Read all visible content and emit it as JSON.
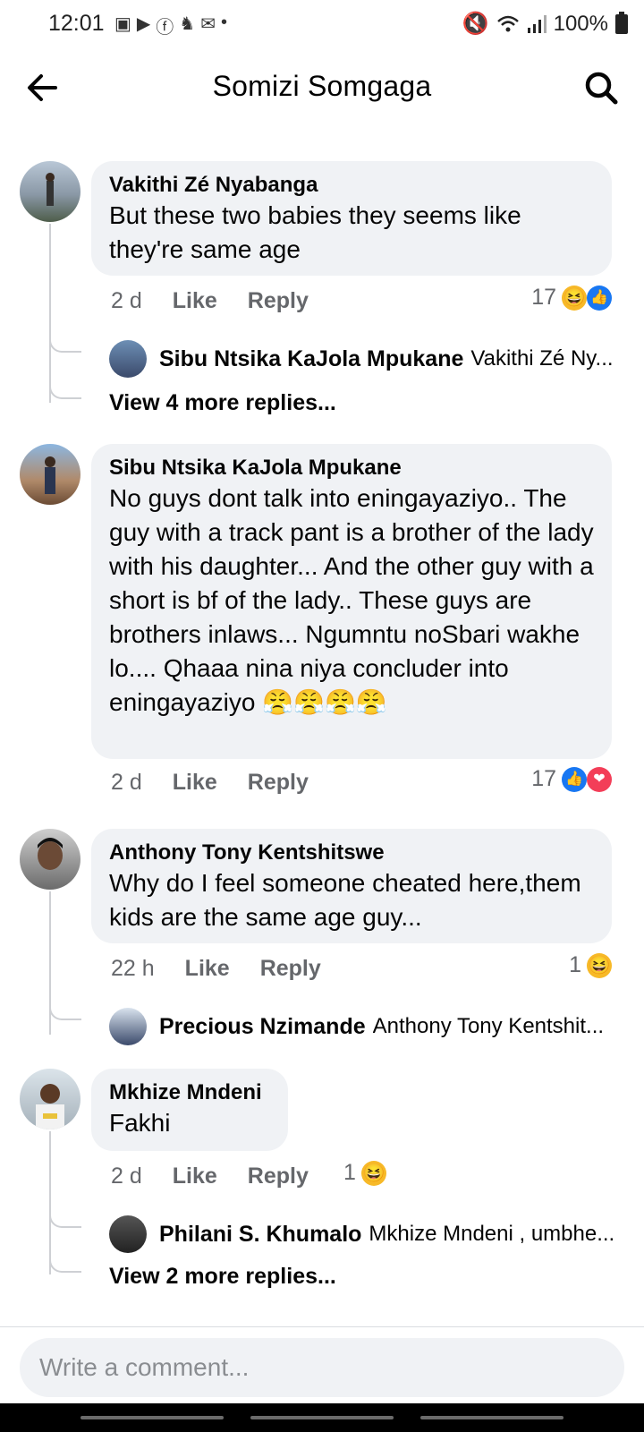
{
  "status_bar": {
    "time": "12:01",
    "battery": "100%",
    "left_icons": [
      "notification-icon",
      "youtube-icon",
      "facebook-icon",
      "app-icon",
      "mail-icon",
      "dot-icon"
    ],
    "right_icons": [
      "mute-icon",
      "wifi-icon",
      "signal-icon",
      "battery-icon"
    ]
  },
  "header": {
    "title": "Somizi Somgaga"
  },
  "comments": [
    {
      "author": "Vakithi Zé Nyabanga",
      "text": "But these two babies they seems like they're same age",
      "time": "2 d",
      "like_label": "Like",
      "reply_label": "Reply",
      "reaction_count": "17",
      "reactions": [
        "laugh",
        "like"
      ],
      "reply_preview": {
        "author": "Sibu Ntsika KaJola Mpukane",
        "snippet": "Vakithi Zé Ny..."
      },
      "more_replies": "View 4 more replies..."
    },
    {
      "author": "Sibu Ntsika KaJola Mpukane",
      "text": "No guys dont talk into eningayaziyo.. The guy with a track pant is a brother of the lady with his daughter... And the other guy with a short is bf of the lady.. These guys are brothers inlaws... Ngumntu noSbari wakhe lo.... Qhaaa nina niya concluder into eningayaziyo 😤😤😤😤",
      "time": "2 d",
      "like_label": "Like",
      "reply_label": "Reply",
      "reaction_count": "17",
      "reactions": [
        "like",
        "love"
      ]
    },
    {
      "author": "Anthony Tony Kentshitswe",
      "text": "Why do I feel someone cheated here,them kids are the same age guy...",
      "time": "22 h",
      "like_label": "Like",
      "reply_label": "Reply",
      "reaction_count": "1",
      "reactions": [
        "laugh"
      ],
      "reply_preview": {
        "author": "Precious Nzimande",
        "snippet": "Anthony Tony Kentshit..."
      }
    },
    {
      "author": "Mkhize Mndeni",
      "text": "Fakhi",
      "time": "2 d",
      "like_label": "Like",
      "reply_label": "Reply",
      "reaction_count": "1",
      "reactions": [
        "laugh"
      ],
      "reply_preview": {
        "author": "Philani S. Khumalo",
        "snippet": "Mkhize Mndeni , umbhe..."
      },
      "more_replies": "View 2 more replies..."
    }
  ],
  "composer": {
    "placeholder": "Write a comment..."
  }
}
